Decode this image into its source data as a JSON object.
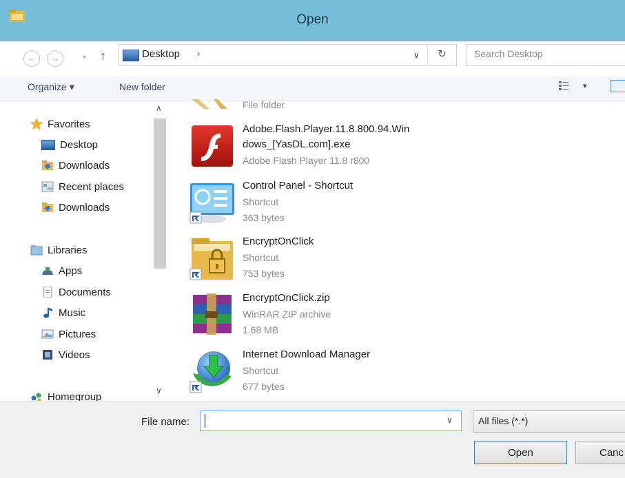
{
  "window": {
    "title": "Open"
  },
  "address": {
    "location": "Desktop",
    "separator": "›",
    "search_placeholder": "Search Desktop"
  },
  "toolbar": {
    "organize": "Organize ▾",
    "new_folder": "New folder"
  },
  "nav": {
    "favorites": "Favorites",
    "favorites_items": [
      "Desktop",
      "Downloads",
      "Recent places",
      "Downloads"
    ],
    "libraries": "Libraries",
    "libraries_items": [
      "Apps",
      "Documents",
      "Music",
      "Pictures",
      "Videos"
    ],
    "homegroup": "Homegroup"
  },
  "files": [
    {
      "name_lines": [],
      "subtitles": [
        "File folder"
      ],
      "icon": "folder-icon"
    },
    {
      "name_lines": [
        "Adobe.Flash.Player.11.8.800.94.Win",
        "dows_[YasDL.com].exe"
      ],
      "subtitles": [
        "Adobe Flash Player 11.8 r800"
      ],
      "icon": "flash-player-icon"
    },
    {
      "name_lines": [
        "Control Panel - Shortcut"
      ],
      "subtitles": [
        "Shortcut",
        "363 bytes"
      ],
      "icon": "control-panel-icon"
    },
    {
      "name_lines": [
        "EncryptOnClick"
      ],
      "subtitles": [
        "Shortcut",
        "753 bytes"
      ],
      "icon": "lock-folder-icon"
    },
    {
      "name_lines": [
        "EncryptOnClick.zip"
      ],
      "subtitles": [
        "WinRAR ZIP archive",
        "1.68 MB"
      ],
      "icon": "winrar-archive-icon"
    },
    {
      "name_lines": [
        "Internet Download Manager"
      ],
      "subtitles": [
        "Shortcut",
        "677 bytes"
      ],
      "icon": "idm-globe-icon"
    }
  ],
  "bottom": {
    "file_name_label": "File name:",
    "file_name_value": "",
    "file_type": "All files (*.*)",
    "open_label": "Open",
    "cancel_label": "Canc"
  },
  "colors": {
    "titlebar": "#76bdd7",
    "accent_border": "#7eb4ea"
  }
}
